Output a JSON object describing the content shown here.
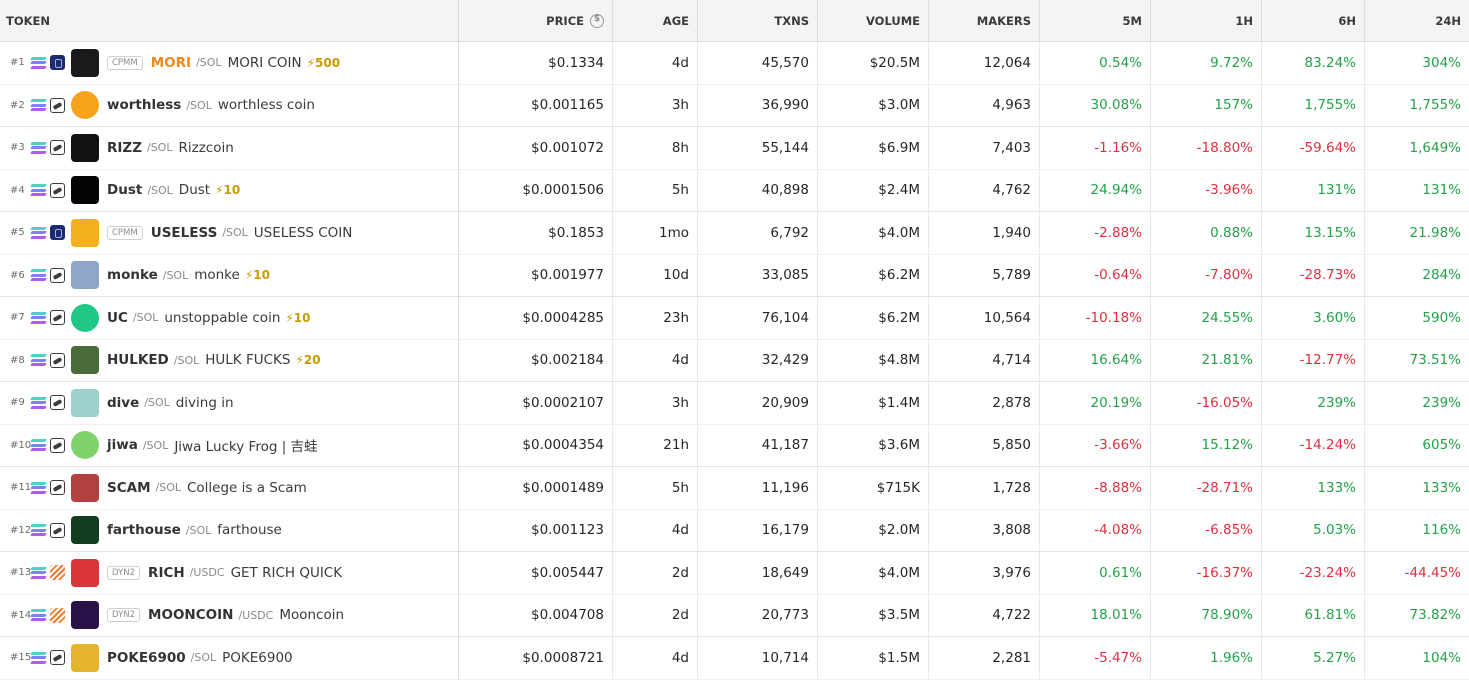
{
  "headers": {
    "token": "TOKEN",
    "price": "PRICE",
    "age": "AGE",
    "txns": "TXNS",
    "volume": "VOLUME",
    "makers": "MAKERS",
    "m5": "5M",
    "h1": "1H",
    "h6": "6H",
    "h24": "24H"
  },
  "colors": {
    "positive": "#24a149",
    "negative": "#e0303e",
    "orange": "#f0881a",
    "boost": "#c99a00"
  },
  "rows": [
    {
      "rank": "#1",
      "dex": "meteora",
      "avatar_color": "#1a1a1a",
      "badge": "CPMM",
      "symbol": "MORI",
      "sym_orange": true,
      "quote": "/SOL",
      "name": "MORI COIN",
      "boost": "⚡500",
      "price": "$0.1334",
      "age": "4d",
      "txns": "45,570",
      "volume": "$20.5M",
      "makers": "12,064",
      "m5": "0.54%",
      "h1": "9.72%",
      "h6": "83.24%",
      "h24": "304%"
    },
    {
      "rank": "#2",
      "dex": "pump",
      "avatar_color": "#f6a21a",
      "badge": "",
      "symbol": "worthless",
      "sym_orange": false,
      "quote": "/SOL",
      "name": "worthless coin",
      "boost": "",
      "price": "$0.001165",
      "age": "3h",
      "txns": "36,990",
      "volume": "$3.0M",
      "makers": "4,963",
      "m5": "30.08%",
      "h1": "157%",
      "h6": "1,755%",
      "h24": "1,755%"
    },
    {
      "rank": "#3",
      "dex": "pump",
      "avatar_color": "#111111",
      "badge": "",
      "symbol": "RIZZ",
      "sym_orange": false,
      "quote": "/SOL",
      "name": "Rizzcoin",
      "boost": "",
      "price": "$0.001072",
      "age": "8h",
      "txns": "55,144",
      "volume": "$6.9M",
      "makers": "7,403",
      "m5": "-1.16%",
      "h1": "-18.80%",
      "h6": "-59.64%",
      "h24": "1,649%"
    },
    {
      "rank": "#4",
      "dex": "pump",
      "avatar_color": "#050505",
      "badge": "",
      "symbol": "Dust",
      "sym_orange": false,
      "quote": "/SOL",
      "name": "Dust",
      "boost": "⚡10",
      "price": "$0.0001506",
      "age": "5h",
      "txns": "40,898",
      "volume": "$2.4M",
      "makers": "4,762",
      "m5": "24.94%",
      "h1": "-3.96%",
      "h6": "131%",
      "h24": "131%"
    },
    {
      "rank": "#5",
      "dex": "meteora",
      "avatar_color": "#f2b01c",
      "badge": "CPMM",
      "symbol": "USELESS",
      "sym_orange": false,
      "quote": "/SOL",
      "name": "USELESS COIN",
      "boost": "",
      "price": "$0.1853",
      "age": "1mo",
      "txns": "6,792",
      "volume": "$4.0M",
      "makers": "1,940",
      "m5": "-2.88%",
      "h1": "0.88%",
      "h6": "13.15%",
      "h24": "21.98%"
    },
    {
      "rank": "#6",
      "dex": "pump",
      "avatar_color": "#8fa6c9",
      "badge": "",
      "symbol": "monke",
      "sym_orange": false,
      "quote": "/SOL",
      "name": "monke",
      "boost": "⚡10",
      "price": "$0.001977",
      "age": "10d",
      "txns": "33,085",
      "volume": "$6.2M",
      "makers": "5,789",
      "m5": "-0.64%",
      "h1": "-7.80%",
      "h6": "-28.73%",
      "h24": "284%"
    },
    {
      "rank": "#7",
      "dex": "pump",
      "avatar_color": "#1fc886",
      "badge": "",
      "symbol": "UC",
      "sym_orange": false,
      "quote": "/SOL",
      "name": "unstoppable coin",
      "boost": "⚡10",
      "price": "$0.0004285",
      "age": "23h",
      "txns": "76,104",
      "volume": "$6.2M",
      "makers": "10,564",
      "m5": "-10.18%",
      "h1": "24.55%",
      "h6": "3.60%",
      "h24": "590%"
    },
    {
      "rank": "#8",
      "dex": "pump",
      "avatar_color": "#4a6a3a",
      "badge": "",
      "symbol": "HULKED",
      "sym_orange": false,
      "quote": "/SOL",
      "name": "HULK FUCKS",
      "boost": "⚡20",
      "price": "$0.002184",
      "age": "4d",
      "txns": "32,429",
      "volume": "$4.8M",
      "makers": "4,714",
      "m5": "16.64%",
      "h1": "21.81%",
      "h6": "-12.77%",
      "h24": "73.51%"
    },
    {
      "rank": "#9",
      "dex": "pump",
      "avatar_color": "#9cd1cf",
      "badge": "",
      "symbol": "dive",
      "sym_orange": false,
      "quote": "/SOL",
      "name": "diving in",
      "boost": "",
      "price": "$0.0002107",
      "age": "3h",
      "txns": "20,909",
      "volume": "$1.4M",
      "makers": "2,878",
      "m5": "20.19%",
      "h1": "-16.05%",
      "h6": "239%",
      "h24": "239%"
    },
    {
      "rank": "#10",
      "dex": "pump",
      "avatar_color": "#7fd36a",
      "badge": "",
      "symbol": "jiwa",
      "sym_orange": false,
      "quote": "/SOL",
      "name": "Jiwa Lucky Frog | 吉蛙",
      "boost": "",
      "price": "$0.0004354",
      "age": "21h",
      "txns": "41,187",
      "volume": "$3.6M",
      "makers": "5,850",
      "m5": "-3.66%",
      "h1": "15.12%",
      "h6": "-14.24%",
      "h24": "605%"
    },
    {
      "rank": "#11",
      "dex": "pump",
      "avatar_color": "#b0413e",
      "badge": "",
      "symbol": "SCAM",
      "sym_orange": false,
      "quote": "/SOL",
      "name": "College is a Scam",
      "boost": "",
      "price": "$0.0001489",
      "age": "5h",
      "txns": "11,196",
      "volume": "$715K",
      "makers": "1,728",
      "m5": "-8.88%",
      "h1": "-28.71%",
      "h6": "133%",
      "h24": "133%"
    },
    {
      "rank": "#12",
      "dex": "pump",
      "avatar_color": "#123d1e",
      "badge": "",
      "symbol": "farthouse",
      "sym_orange": false,
      "quote": "/SOL",
      "name": "farthouse",
      "boost": "",
      "price": "$0.001123",
      "age": "4d",
      "txns": "16,179",
      "volume": "$2.0M",
      "makers": "3,808",
      "m5": "-4.08%",
      "h1": "-6.85%",
      "h6": "5.03%",
      "h24": "116%"
    },
    {
      "rank": "#13",
      "dex": "stripes",
      "avatar_color": "#d9353a",
      "badge": "DYN2",
      "symbol": "RICH",
      "sym_orange": false,
      "quote": "/USDC",
      "name": "GET RICH QUICK",
      "boost": "",
      "price": "$0.005447",
      "age": "2d",
      "txns": "18,649",
      "volume": "$4.0M",
      "makers": "3,976",
      "m5": "0.61%",
      "h1": "-16.37%",
      "h6": "-23.24%",
      "h24": "-44.45%"
    },
    {
      "rank": "#14",
      "dex": "stripes",
      "avatar_color": "#2a1248",
      "badge": "DYN2",
      "symbol": "MOONCOIN",
      "sym_orange": false,
      "quote": "/USDC",
      "name": "Mooncoin",
      "boost": "",
      "price": "$0.004708",
      "age": "2d",
      "txns": "20,773",
      "volume": "$3.5M",
      "makers": "4,722",
      "m5": "18.01%",
      "h1": "78.90%",
      "h6": "61.81%",
      "h24": "73.82%"
    },
    {
      "rank": "#15",
      "dex": "pump",
      "avatar_color": "#e4b52a",
      "badge": "",
      "symbol": "POKE6900",
      "sym_orange": false,
      "quote": "/SOL",
      "name": "POKE6900",
      "boost": "",
      "price": "$0.0008721",
      "age": "4d",
      "txns": "10,714",
      "volume": "$1.5M",
      "makers": "2,281",
      "m5": "-5.47%",
      "h1": "1.96%",
      "h6": "5.27%",
      "h24": "104%"
    }
  ]
}
